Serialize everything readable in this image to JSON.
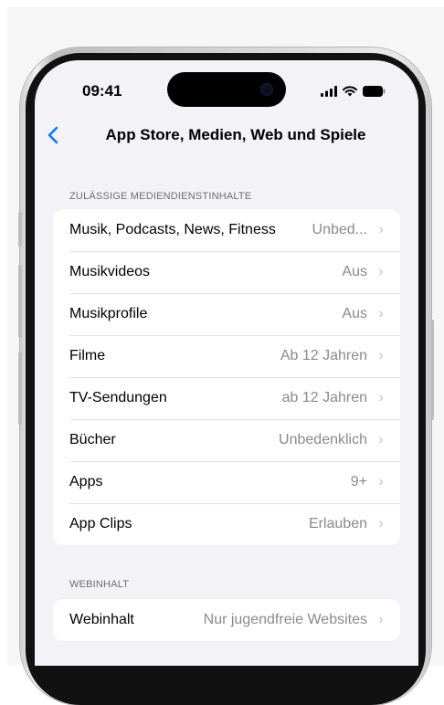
{
  "status": {
    "time": "09:41"
  },
  "nav": {
    "title": "App Store, Medien, Web und Spiele"
  },
  "sections": [
    {
      "header": "ZULÄSSIGE MEDIENDIENSTINHALTE",
      "rows": [
        {
          "label": "Musik, Podcasts, News, Fitness",
          "value": "Unbed..."
        },
        {
          "label": "Musikvideos",
          "value": "Aus"
        },
        {
          "label": "Musikprofile",
          "value": "Aus"
        },
        {
          "label": "Filme",
          "value": "Ab 12 Jahren"
        },
        {
          "label": "TV-Sendungen",
          "value": "ab 12 Jahren"
        },
        {
          "label": "Bücher",
          "value": "Unbedenklich"
        },
        {
          "label": "Apps",
          "value": "9+"
        },
        {
          "label": "App Clips",
          "value": "Erlauben"
        }
      ]
    },
    {
      "header": "WEBINHALT",
      "rows": [
        {
          "label": "Webinhalt",
          "value": "Nur jugendfreie Websites"
        }
      ]
    }
  ],
  "colors": {
    "accent": "#0a7aff",
    "background": "#f2f2f7",
    "secondary_text": "#8a8a8e"
  },
  "icons": [
    "back-chevron-icon",
    "cellular-signal-icon",
    "wifi-icon",
    "battery-icon",
    "chevron-right-icon"
  ]
}
